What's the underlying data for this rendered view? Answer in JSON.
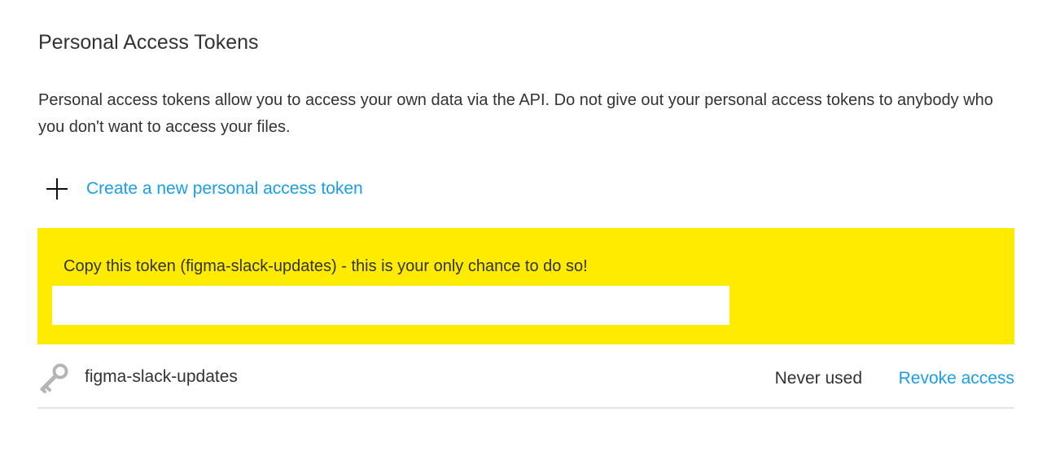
{
  "section": {
    "title": "Personal Access Tokens",
    "description": "Personal access tokens allow you to access your own data via the API. Do not give out your personal access tokens to anybody who you don't want to access your files."
  },
  "create": {
    "icon": "plus-icon",
    "label": "Create a new personal access token"
  },
  "notice": {
    "background_color": "#ffeb00",
    "message": "Copy this token (figma-slack-updates) - this is your only chance to do so!",
    "token_value": ""
  },
  "tokens": [
    {
      "icon": "key-icon",
      "name": "figma-slack-updates",
      "status": "Never used",
      "action_label": "Revoke access"
    }
  ],
  "colors": {
    "link": "#1a9ee8",
    "text": "#333333",
    "divider": "#e4e4e4"
  }
}
